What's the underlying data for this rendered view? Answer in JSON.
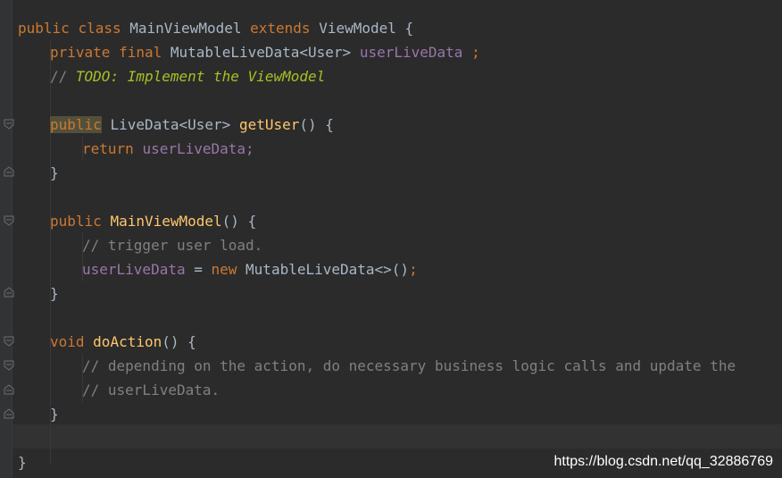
{
  "editor": {
    "lines": {
      "l1": [
        "public",
        "class",
        "MainViewModel",
        "extends",
        "ViewModel",
        "{"
      ],
      "l2": [
        "private",
        "final",
        "MutableLiveData<User>",
        "userLiveData",
        ";"
      ],
      "l3": [
        "// ",
        "TODO: Implement the ViewModel"
      ],
      "l5": [
        "public",
        "LiveData<User>",
        "getUser",
        "()",
        "{"
      ],
      "l6": [
        "return",
        "userLiveData;"
      ],
      "l7": "}",
      "l9": [
        "public",
        "MainViewModel",
        "()",
        "{"
      ],
      "l10": "// trigger user load.",
      "l11": [
        "userLiveData",
        " = ",
        "new",
        " MutableLiveData<>()",
        ";"
      ],
      "l12": "}",
      "l14": [
        "void",
        "doAction",
        "()",
        "{"
      ],
      "l15": "// depending on the action, do necessary business logic calls and update the",
      "l16": "// userLiveData.",
      "l17": "}",
      "l19": "}"
    }
  },
  "watermark": "https://blog.csdn.net/qq_32886769",
  "colors": {
    "background": "#2b2b2b",
    "keyword": "#cc7832",
    "method": "#ffc66d",
    "field": "#9876aa",
    "comment": "#808080",
    "todo": "#a8c023",
    "plain": "#a9b7c6"
  }
}
